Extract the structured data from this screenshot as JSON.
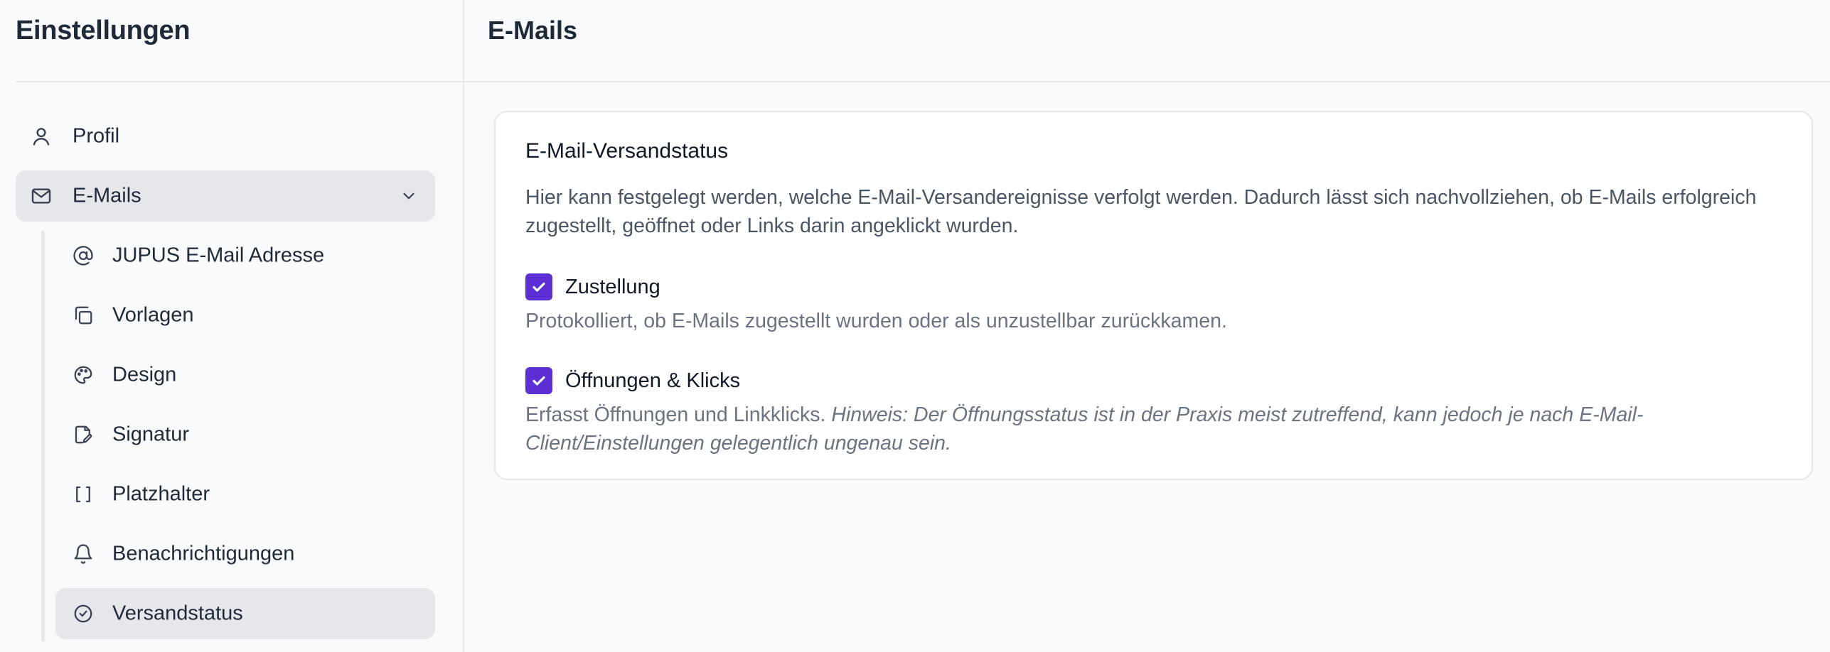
{
  "sidebar": {
    "title": "Einstellungen",
    "items": [
      {
        "label": "Profil",
        "icon": "user-icon"
      },
      {
        "label": "E-Mails",
        "icon": "mail-icon",
        "expanded": true
      }
    ],
    "sub_items": [
      {
        "label": "JUPUS E-Mail Adresse",
        "icon": "at-sign-icon"
      },
      {
        "label": "Vorlagen",
        "icon": "copy-icon"
      },
      {
        "label": "Design",
        "icon": "palette-icon"
      },
      {
        "label": "Signatur",
        "icon": "file-signature-icon"
      },
      {
        "label": "Platzhalter",
        "icon": "brackets-icon"
      },
      {
        "label": "Benachrichtigungen",
        "icon": "bell-icon"
      },
      {
        "label": "Versandstatus",
        "icon": "check-circle-icon",
        "active": true
      }
    ]
  },
  "main": {
    "title": "E-Mails",
    "card": {
      "title": "E-Mail-Versandstatus",
      "description": "Hier kann festgelegt werden, welche E-Mail-Versandereignisse verfolgt werden. Dadurch lässt sich nachvollziehen, ob E-Mails erfolgreich zugestellt, geöffnet oder Links darin angeklickt wurden.",
      "options": [
        {
          "label": "Zustellung",
          "checked": true,
          "help": "Protokolliert, ob E-Mails zugestellt wurden oder als unzustellbar zurückkamen."
        },
        {
          "label": "Öffnungen & Klicks",
          "checked": true,
          "help": "Erfasst Öffnungen und Linkklicks.",
          "note": "Hinweis: Der Öffnungsstatus ist in der Praxis meist zutreffend, kann jedoch je nach E-Mail-Client/Einstellungen gelegentlich ungenau sein."
        }
      ]
    }
  },
  "colors": {
    "accent": "#5b2fd3",
    "active_bg": "#e5e7eb",
    "page_bg": "#f9fafb"
  }
}
